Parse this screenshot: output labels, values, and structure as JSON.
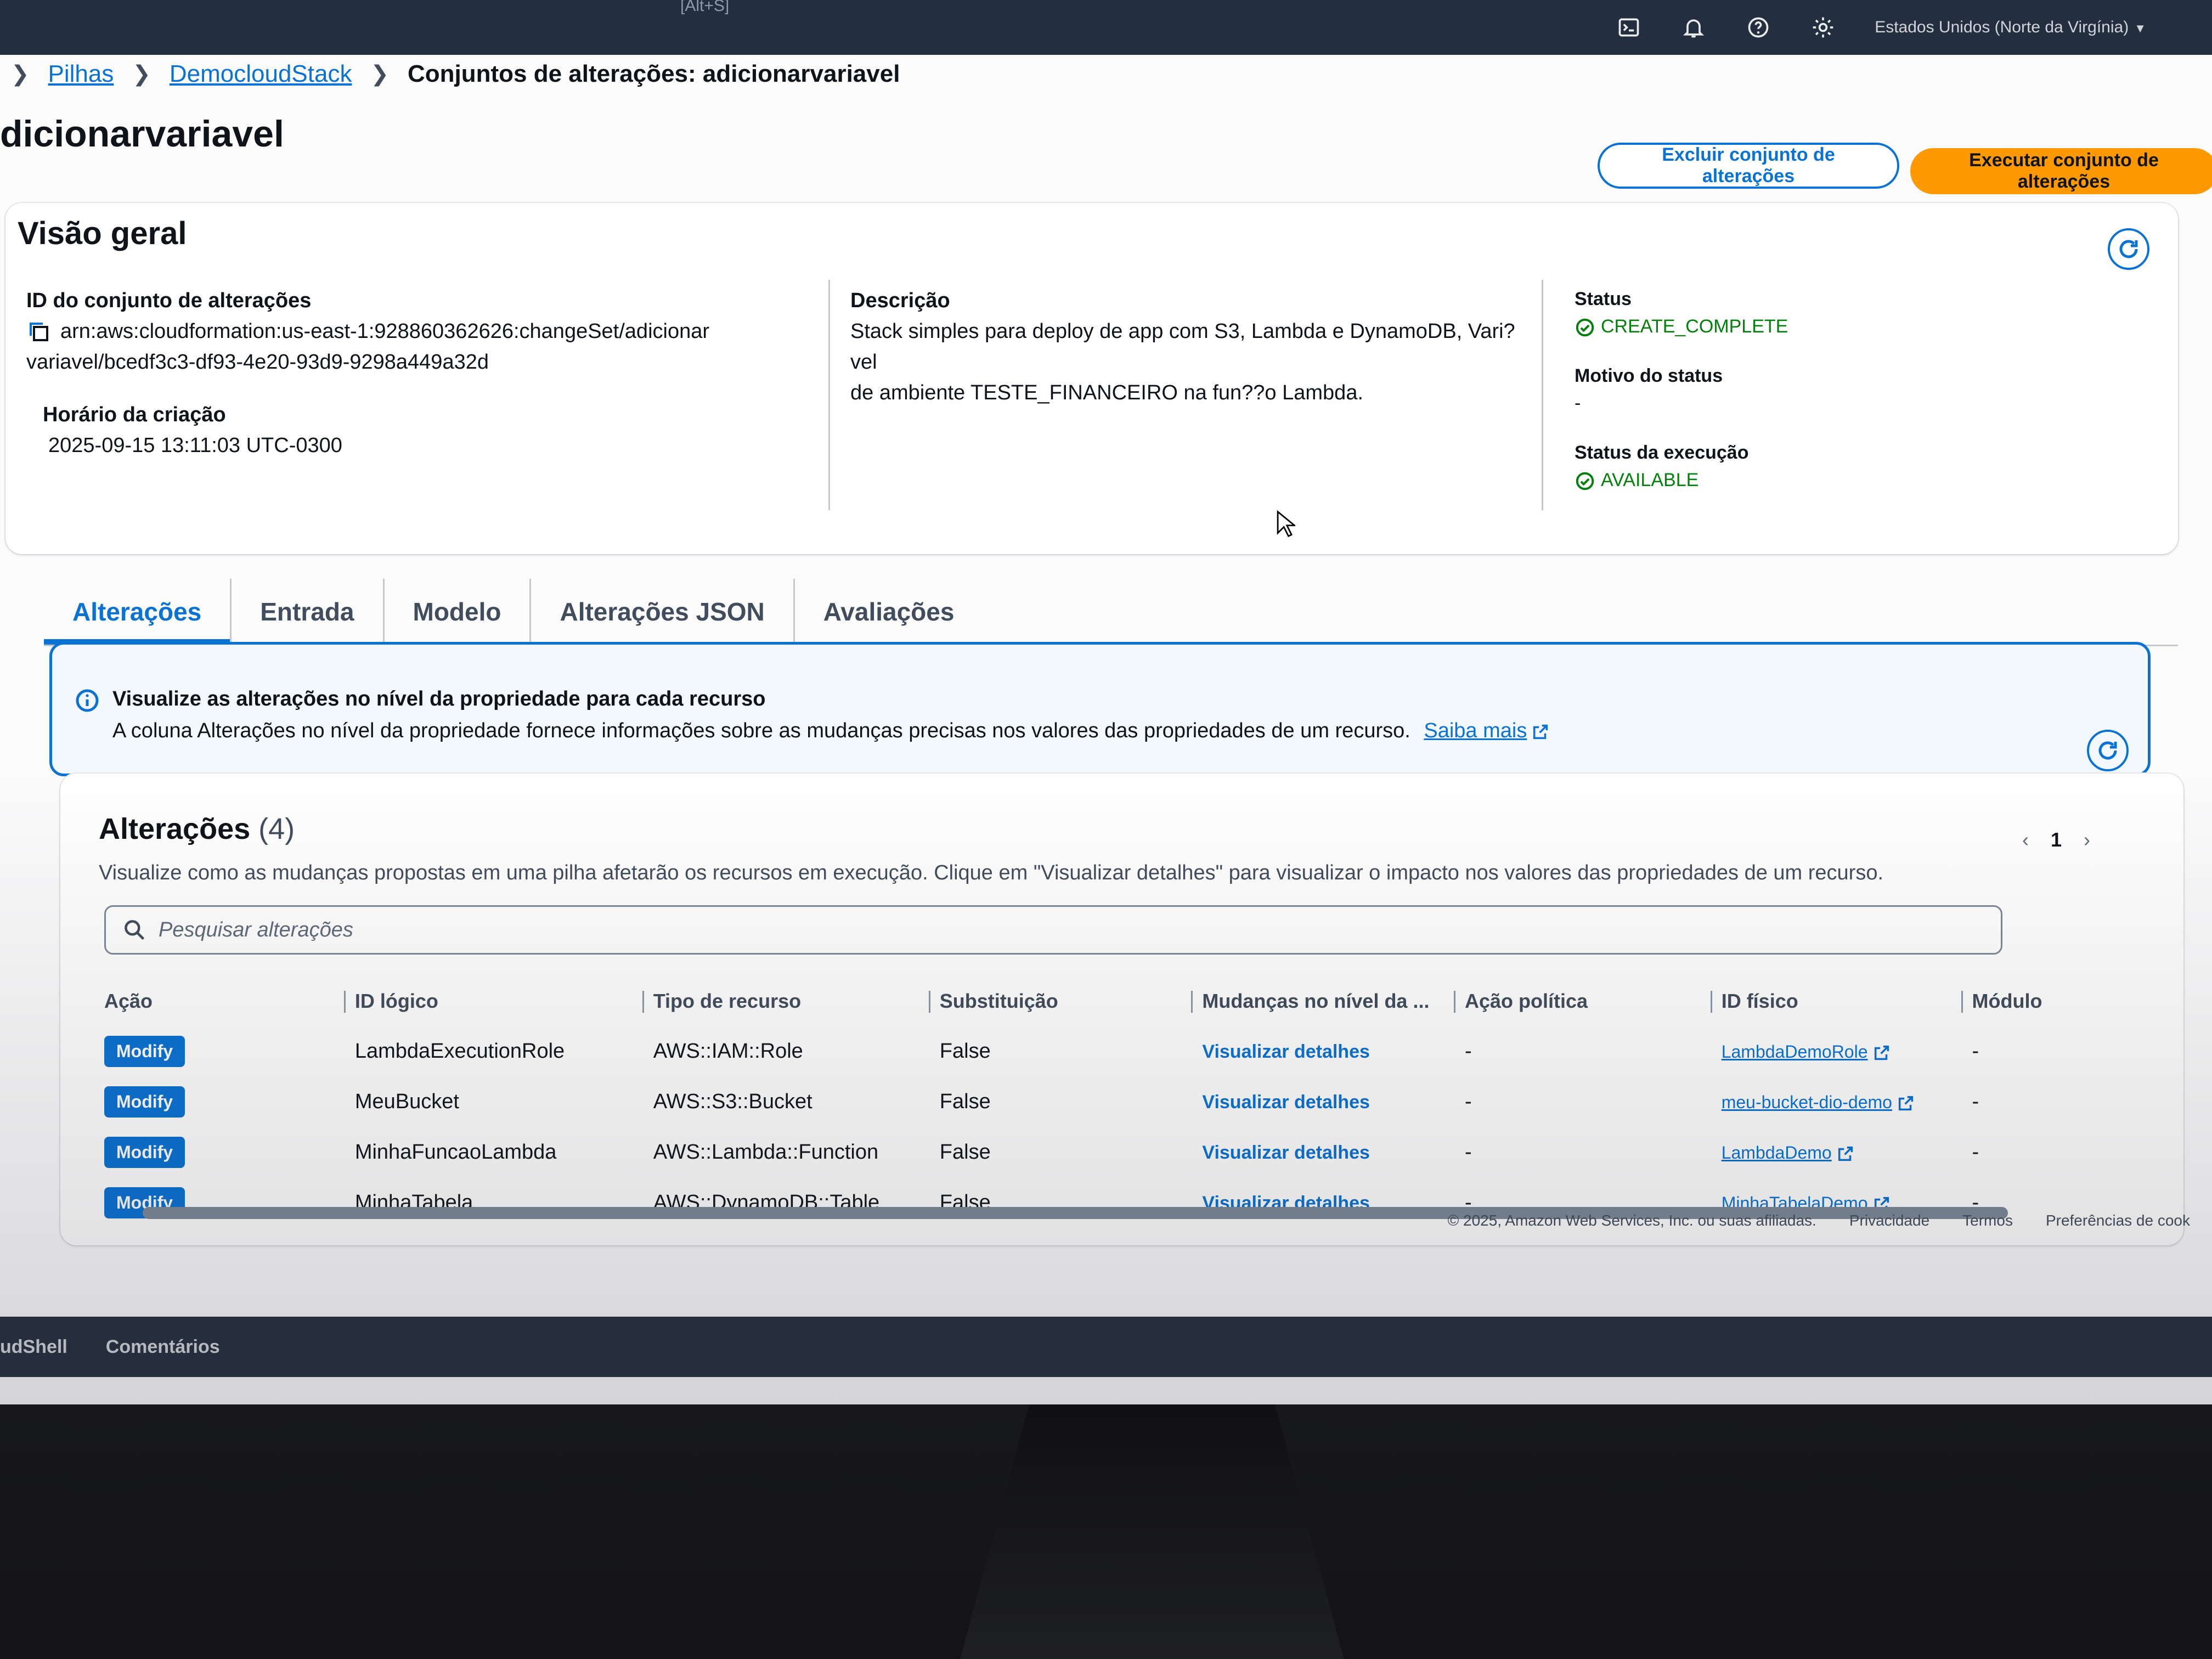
{
  "topnav": {
    "shortcut_hint": "[Alt+S]",
    "region": "Estados Unidos (Norte da Virgínia)",
    "icons": [
      "cloudshell-icon",
      "bell-icon",
      "help-icon",
      "gear-icon"
    ]
  },
  "breadcrumb": {
    "items": [
      "Pilhas",
      "DemocloudStack"
    ],
    "current": "Conjuntos de alterações: adicionarvariavel"
  },
  "page": {
    "title": "dicionarvariavel",
    "delete_button": "Excluir conjunto de alterações",
    "execute_button": "Executar conjunto de alterações"
  },
  "overview": {
    "title": "Visão geral",
    "changeset_id_label": "ID do conjunto de alterações",
    "changeset_id_line1": "arn:aws:cloudformation:us-east-1:928860362626:changeSet/adicionar",
    "changeset_id_line2": "variavel/bcedf3c3-df93-4e20-93d9-9298a449a32d",
    "created_label": "Horário da criação",
    "created_value": "2025-09-15 13:11:03 UTC-0300",
    "description_label": "Descrição",
    "description_line1": "Stack simples para deploy de app com S3, Lambda e DynamoDB, Vari?vel",
    "description_line2": "de ambiente TESTE_FINANCEIRO na fun??o Lambda.",
    "status_label": "Status",
    "status_value": "CREATE_COMPLETE",
    "status_reason_label": "Motivo do status",
    "status_reason_value": "-",
    "exec_status_label": "Status da execução",
    "exec_status_value": "AVAILABLE"
  },
  "tabs": [
    "Alterações",
    "Entrada",
    "Modelo",
    "Alterações JSON",
    "Avaliações"
  ],
  "alert": {
    "title": "Visualize as alterações no nível da propriedade para cada recurso",
    "body": "A coluna Alterações no nível da propriedade fornece informações sobre as mudanças precisas nos valores das propriedades de um recurso.",
    "link": "Saiba mais"
  },
  "changes": {
    "title": "Alterações",
    "count": "(4)",
    "description": "Visualize como as mudanças propostas em uma pilha afetarão os recursos em execução. Clique em \"Visualizar detalhes\" para visualizar o impacto nos valores das propriedades de um recurso.",
    "search_placeholder": "Pesquisar alterações",
    "page": "1",
    "columns": [
      "Ação",
      "ID lógico",
      "Tipo de recurso",
      "Substituição",
      "Mudanças no nível da ...",
      "Ação política",
      "ID físico",
      "Módulo"
    ],
    "rows": [
      {
        "action": "Modify",
        "logical_id": "LambdaExecutionRole",
        "type": "AWS::IAM::Role",
        "replacement": "False",
        "details": "Visualizar detalhes",
        "policy": "-",
        "physical_id": "LambdaDemoRole",
        "module": "-"
      },
      {
        "action": "Modify",
        "logical_id": "MeuBucket",
        "type": "AWS::S3::Bucket",
        "replacement": "False",
        "details": "Visualizar detalhes",
        "policy": "-",
        "physical_id": "meu-bucket-dio-demo",
        "module": "-"
      },
      {
        "action": "Modify",
        "logical_id": "MinhaFuncaoLambda",
        "type": "AWS::Lambda::Function",
        "replacement": "False",
        "details": "Visualizar detalhes",
        "policy": "-",
        "physical_id": "LambdaDemo",
        "module": "-"
      },
      {
        "action": "Modify",
        "logical_id": "MinhaTabela",
        "type": "AWS::DynamoDB::Table",
        "replacement": "False",
        "details": "Visualizar detalhes",
        "policy": "-",
        "physical_id": "MinhaTabelaDemo",
        "module": "-"
      }
    ]
  },
  "footer": {
    "copyright": "© 2025, Amazon Web Services, Inc. ou suas afiliadas.",
    "links": [
      "Privacidade",
      "Termos",
      "Preferências de cook"
    ],
    "bottom_left": [
      "udShell",
      "Comentários"
    ]
  },
  "colors": {
    "nav_bg": "#232f3e",
    "link": "#0972d3",
    "primary_button": "#ff9900",
    "success": "#037f0c"
  }
}
